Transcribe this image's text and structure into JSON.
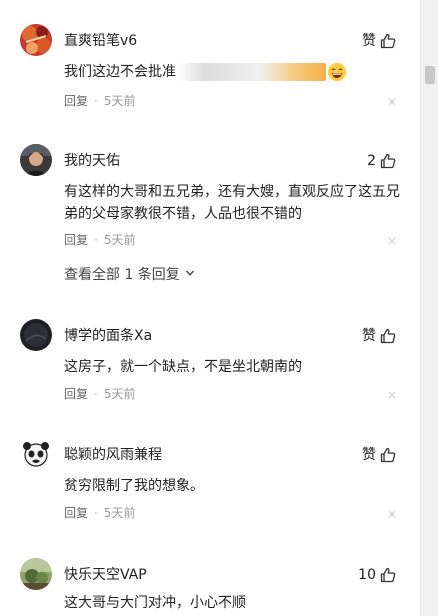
{
  "comments": [
    {
      "username": "直爽铅笔v6",
      "like": "赞",
      "text": "我们这边不会批准",
      "reply": "回复",
      "time": "5天前"
    },
    {
      "username": "我的天佑",
      "like": "2",
      "text": "有这样的大哥和五兄弟，还有大嫂，直观反应了这五兄弟的父母家教很不错，人品也很不错的",
      "reply": "回复",
      "time": "5天前"
    },
    {
      "username": "博学的面条Xa",
      "like": "赞",
      "text": "这房子，就一个缺点，不是坐北朝南的",
      "reply": "回复",
      "time": "5天前"
    },
    {
      "username": "聪颖的风雨兼程",
      "like": "赞",
      "text": "贫穷限制了我的想象。",
      "reply": "回复",
      "time": "5天前"
    },
    {
      "username": "快乐天空VAP",
      "like": "10",
      "text": "这大哥与大门对冲，小心不顺"
    }
  ],
  "view_replies": "查看全部 1 条回复",
  "icons": {
    "like": "thumbs-up-icon",
    "close": "close-icon",
    "expand": "chevron-down-icon",
    "emoji": "grinning-emoji-icon"
  }
}
